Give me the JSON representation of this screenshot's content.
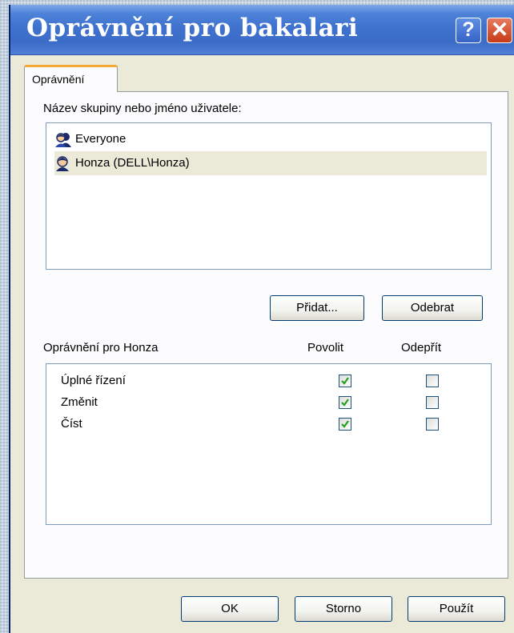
{
  "window": {
    "title": "Oprávnění pro bakalari",
    "help_button": "?",
    "close_button": "✕"
  },
  "tab": {
    "label": "Oprávnění"
  },
  "users": {
    "label": "Název skupiny nebo jméno uživatele:",
    "items": [
      {
        "name": "Everyone",
        "icon": "group-icon",
        "selected": false
      },
      {
        "name": "Honza (DELL\\Honza)",
        "icon": "user-icon",
        "selected": true
      }
    ],
    "add_button": "Přidat...",
    "remove_button": "Odebrat"
  },
  "permissions": {
    "header": "Oprávnění pro Honza",
    "allow_header": "Povolit",
    "deny_header": "Odepřít",
    "rows": [
      {
        "name": "Úplné řízení",
        "allow": true,
        "deny": false
      },
      {
        "name": "Změnit",
        "allow": true,
        "deny": false
      },
      {
        "name": "Číst",
        "allow": true,
        "deny": false
      }
    ]
  },
  "footer": {
    "ok_button": "OK",
    "cancel_button": "Storno",
    "apply_button": "Použít"
  },
  "colors": {
    "titlebar": "#3a6cc8",
    "dialog_bg": "#ebe9d8",
    "check_green": "#21a121",
    "tab_accent": "#f2a932"
  }
}
